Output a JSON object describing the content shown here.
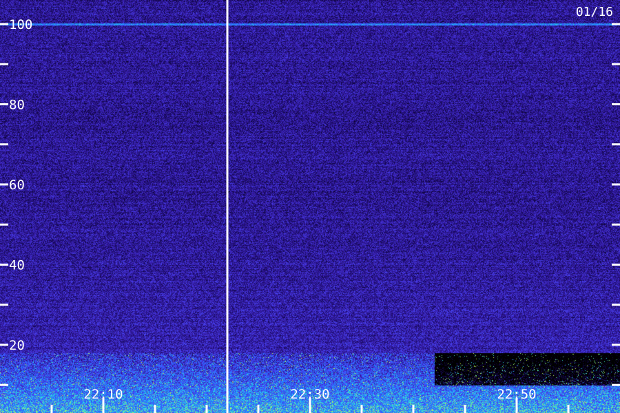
{
  "chart_data": {
    "type": "heatmap",
    "title": "",
    "date_label": "01/16",
    "xlabel": "",
    "ylabel": "",
    "y_ticks": [
      100,
      90,
      80,
      70,
      60,
      50,
      40,
      30,
      20,
      10,
      0
    ],
    "y_labels": [
      {
        "value": 100,
        "text": "100"
      },
      {
        "value": 80,
        "text": "80"
      },
      {
        "value": 60,
        "text": "60"
      },
      {
        "value": 40,
        "text": "40"
      },
      {
        "value": 20,
        "text": "20"
      }
    ],
    "ylim": [
      3,
      106
    ],
    "x_start_minute": 1320,
    "x_end_minute": 1380,
    "x_minor_tick_step_min": 5,
    "x_labels": [
      {
        "minute": 1330,
        "text": "22:10"
      },
      {
        "minute": 1350,
        "text": "22:30"
      },
      {
        "minute": 1370,
        "text": "22:50"
      }
    ],
    "x_major_tick_minutes": [
      1330,
      1350,
      1370
    ],
    "marker_line_minute": 1342,
    "colormap": [
      "#000000",
      "#1a0a66",
      "#3a1fb0",
      "#4a4aff",
      "#1e7aff",
      "#2ad8e8",
      "#d4ff3a"
    ],
    "background_color": "#2b1490",
    "features": [
      {
        "name": "narrowband line",
        "frequency": 100,
        "intensity": "high"
      },
      {
        "name": "low-frequency band",
        "frequency_range": [
          0,
          18
        ],
        "intensity": "high"
      }
    ],
    "grid": false
  }
}
